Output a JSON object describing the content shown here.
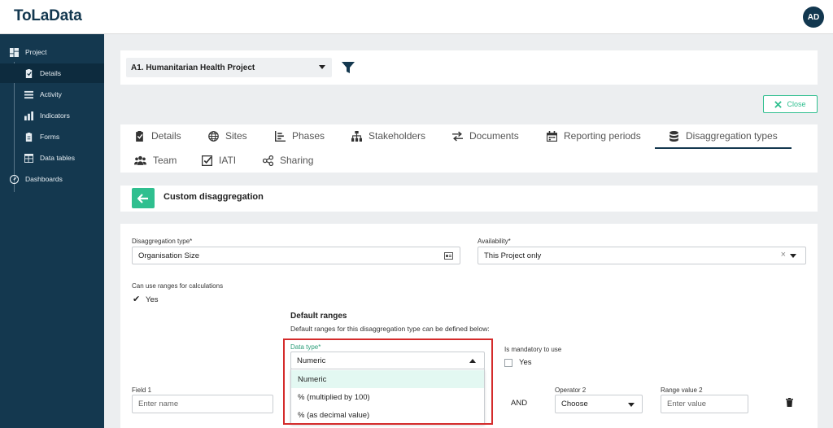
{
  "app": {
    "logo": "ToLaData",
    "user_initials": "AD"
  },
  "sidebar": {
    "items": [
      {
        "label": "Project",
        "icon": "dashboard-icon"
      },
      {
        "label": "Details",
        "icon": "clipboard-check-icon"
      },
      {
        "label": "Activity",
        "icon": "list-icon"
      },
      {
        "label": "Indicators",
        "icon": "bar-chart-icon"
      },
      {
        "label": "Forms",
        "icon": "clipboard-icon"
      },
      {
        "label": "Data tables",
        "icon": "table-icon"
      },
      {
        "label": "Dashboards",
        "icon": "gauge-icon"
      }
    ]
  },
  "project": {
    "selected": "A1. Humanitarian Health Project"
  },
  "actions": {
    "close_label": "Close"
  },
  "tabs": [
    {
      "label": "Details"
    },
    {
      "label": "Sites"
    },
    {
      "label": "Phases"
    },
    {
      "label": "Stakeholders"
    },
    {
      "label": "Documents"
    },
    {
      "label": "Reporting periods"
    },
    {
      "label": "Disaggregation types",
      "active": true
    },
    {
      "label": "Team"
    },
    {
      "label": "IATI"
    },
    {
      "label": "Sharing"
    }
  ],
  "section": {
    "title": "Custom disaggregation"
  },
  "form": {
    "disaggregation_type_label": "Disaggregation type*",
    "disaggregation_type_value": "Organisation Size",
    "availability_label": "Availability*",
    "availability_value": "This Project only",
    "ranges_label": "Can use ranges for calculations",
    "ranges_yes": "Yes",
    "default_ranges_title": "Default ranges",
    "default_ranges_desc": "Default ranges for this disaggregation type can be defined below:",
    "data_type_label": "Data type*",
    "data_type_value": "Numeric",
    "data_type_options": [
      "Numeric",
      "% (multiplied by 100)",
      "% (as decimal value)"
    ],
    "mandatory_label": "Is mandatory to use",
    "mandatory_yes": "Yes",
    "field1_label": "Field 1",
    "field1_placeholder": "Enter name",
    "and_text": "AND",
    "operator2_label": "Operator 2",
    "operator2_value": "Choose",
    "range2_label": "Range value 2",
    "range2_placeholder": "Enter value"
  },
  "colors": {
    "sidebar": "#14384f",
    "accent": "#2fbf8f",
    "highlight": "#d42b2b"
  }
}
